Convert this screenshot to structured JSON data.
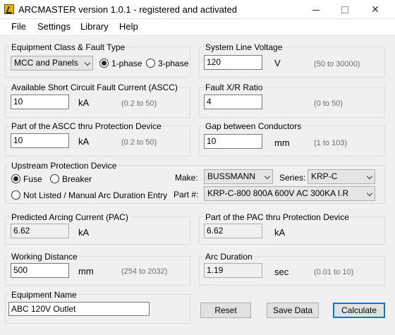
{
  "window": {
    "title": "ARCMASTER version 1.0.1 - registered and activated",
    "controls": {
      "minimize": "",
      "maximize": "",
      "close": "✕"
    }
  },
  "menu": [
    "File",
    "Settings",
    "Library",
    "Help"
  ],
  "equipment_class": {
    "group_label": "Equipment Class & Fault Type",
    "selected": "MCC and Panels",
    "phase_options": [
      "1-phase",
      "3-phase"
    ],
    "selected_phase": "1-phase"
  },
  "system_voltage": {
    "label": "System Line Voltage",
    "value": "120",
    "unit": "V",
    "range": "(50 to 30000)"
  },
  "ascc": {
    "label": "Available Short Circuit Fault Current (ASCC)",
    "value": "10",
    "unit": "kA",
    "range": "(0.2 to 50)"
  },
  "xr_ratio": {
    "label": "Fault X/R Ratio",
    "value": "4",
    "range": "(0 to 50)"
  },
  "ascc_part": {
    "label": "Part of the ASCC thru Protection Device",
    "value": "10",
    "unit": "kA",
    "range": "(0.2 to 50)"
  },
  "gap": {
    "label": "Gap between Conductors",
    "value": "10",
    "unit": "mm",
    "range": "(1 to 103)"
  },
  "upstream": {
    "group_label": "Upstream Protection Device",
    "options": [
      "Fuse",
      "Breaker",
      "Not Listed / Manual Arc Duration Entry"
    ],
    "selected": "Fuse",
    "make_label": "Make:",
    "make_value": "BUSSMANN",
    "series_label": "Series:",
    "series_value": "KRP-C",
    "part_label": "Part #:",
    "part_value": "KRP-C-800 800A 600V AC 300KA I.R"
  },
  "pac": {
    "label": "Predicted Arcing Current (PAC)",
    "value": "6.62",
    "unit": "kA"
  },
  "pac_part": {
    "label": "Part of the PAC thru Protection Device",
    "value": "6.62",
    "unit": "kA"
  },
  "working_distance": {
    "label": "Working Distance",
    "value": "500",
    "unit": "mm",
    "range": "(254 to 2032)"
  },
  "arc_duration": {
    "label": "Arc Duration",
    "value": "1.19",
    "unit": "sec",
    "range": "(0.01 to 10)"
  },
  "equipment_name": {
    "label": "Equipment Name",
    "value": "ABC 120V Outlet"
  },
  "buttons": {
    "reset": "Reset",
    "save": "Save Data",
    "calculate": "Calculate"
  }
}
